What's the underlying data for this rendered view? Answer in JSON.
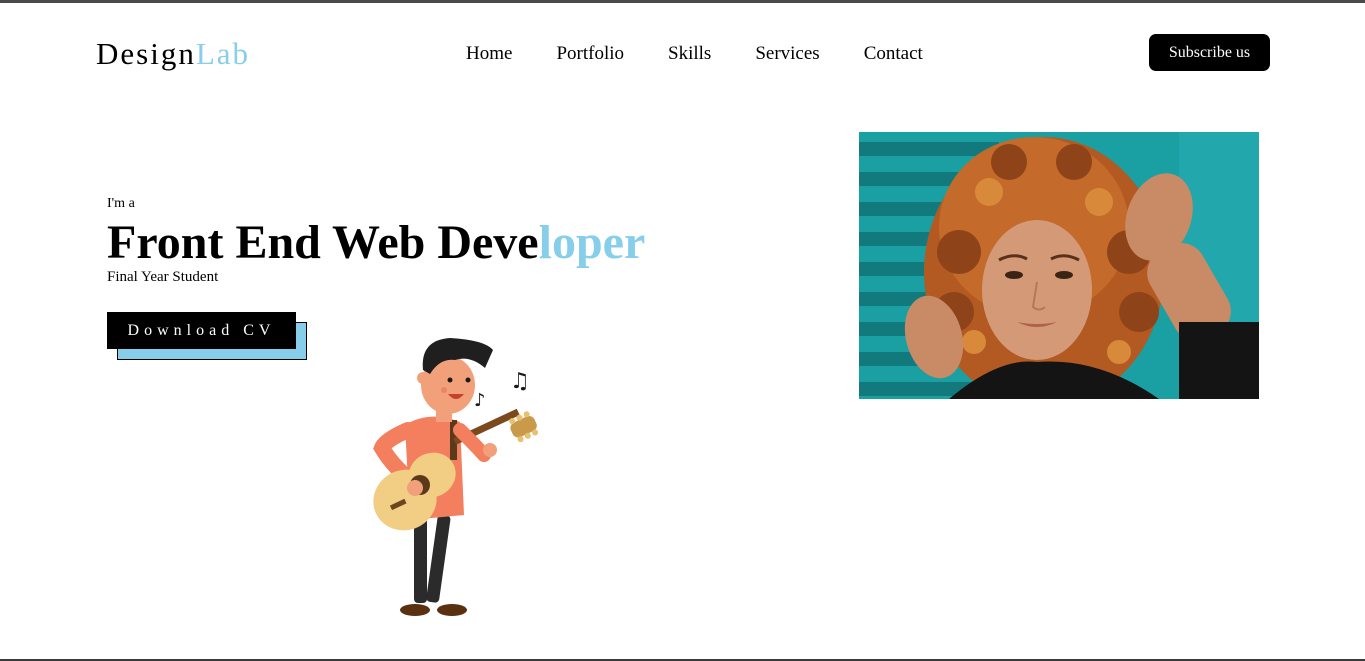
{
  "header": {
    "logo_main": "Design",
    "logo_accent": "Lab",
    "nav": [
      "Home",
      "Portfolio",
      "Skills",
      "Services",
      "Contact"
    ],
    "subscribe_label": "Subscribe us"
  },
  "hero": {
    "intro": "I'm a",
    "headline_main": "Front End Web Deve",
    "headline_accent": "loper",
    "subline": "Final Year Student",
    "cv_button": "Download CV"
  },
  "colors": {
    "accent": "#87ceeb",
    "button_bg": "#000000",
    "photo_bg": "#1a9fa3"
  },
  "icons": {
    "illustration": "guitar-player-illustration",
    "photo": "profile-photo"
  }
}
